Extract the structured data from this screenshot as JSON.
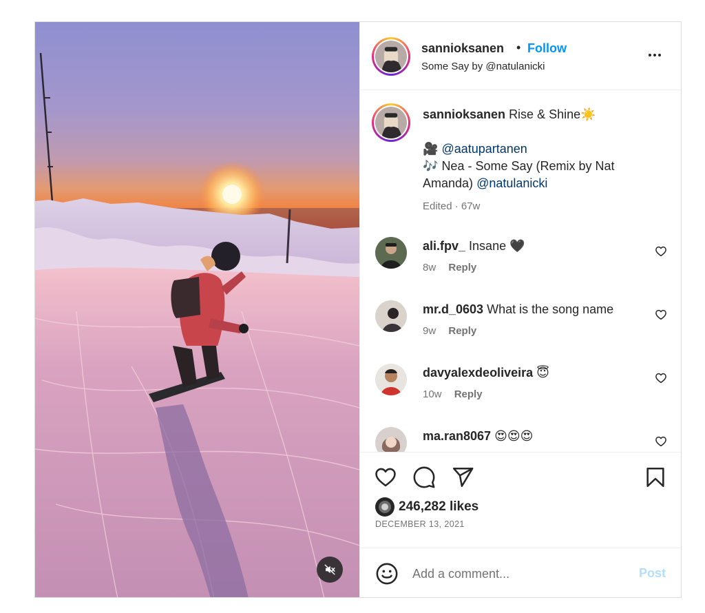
{
  "post": {
    "author": {
      "username": "sannioksanen",
      "follow_label": "Follow",
      "separator": "•",
      "audio_subtitle": "Some Say by @natulanicki"
    },
    "caption": {
      "username": "sannioksanen",
      "headline": "Rise & Shine",
      "headline_emoji": "☀️",
      "camera_emoji": "🎥",
      "camera_mention": "@aatupartanen",
      "music_emoji": "🎶",
      "music_text": "Nea - Some Say (Remix by Nat Amanda)",
      "music_mention": "@natulanicki",
      "edited_meta": "Edited · 67w"
    },
    "comments": [
      {
        "username": "ali.fpv_",
        "text": "Insane 🖤",
        "age": "8w",
        "reply_label": "Reply"
      },
      {
        "username": "mr.d_0603",
        "text": "What is the song name",
        "age": "9w",
        "reply_label": "Reply"
      },
      {
        "username": "davyalexdeoliveira",
        "text": "😇",
        "age": "10w",
        "reply_label": "Reply"
      },
      {
        "username": "ma.ran8067",
        "text": "😍😍😍",
        "age": "",
        "reply_label": ""
      }
    ],
    "likes": "246,282 likes",
    "date": "DECEMBER 13, 2021",
    "composer": {
      "placeholder": "Add a comment...",
      "post_label": "Post"
    }
  },
  "icons": {
    "more": "more-options-icon",
    "like": "heart-icon",
    "comment": "comment-icon",
    "share": "send-icon",
    "save": "bookmark-icon",
    "emoji": "emoji-icon",
    "mute": "muted-speaker-icon"
  },
  "colors": {
    "accent": "#0095f6",
    "mention": "#00376b",
    "post_disabled": "#b2dffc",
    "muted_text": "#737373"
  }
}
